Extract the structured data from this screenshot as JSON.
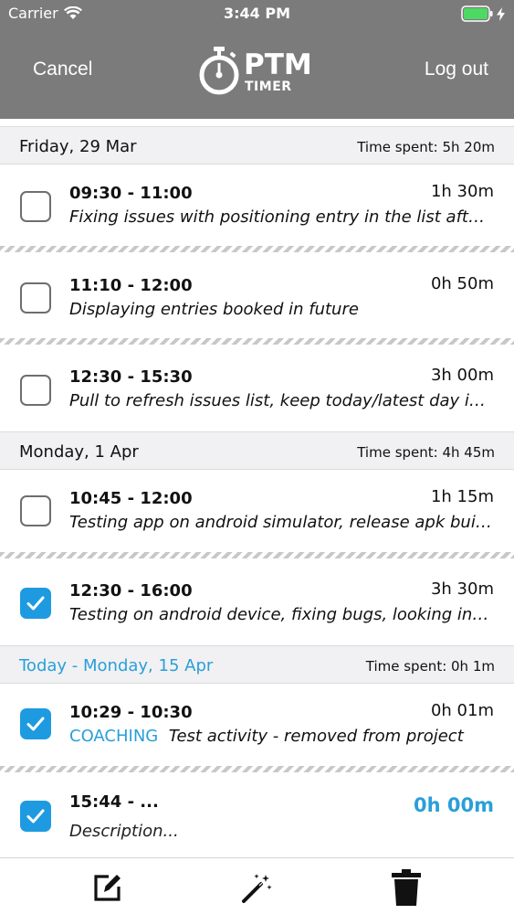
{
  "status_bar": {
    "carrier": "Carrier",
    "time": "3:44 PM",
    "battery_color": "#4cd964"
  },
  "header": {
    "cancel_label": "Cancel",
    "logout_label": "Log out",
    "logo_main": "PTM",
    "logo_sub": "TIMER"
  },
  "sections": [
    {
      "date": "Friday, 29 Mar",
      "time_spent": "Time spent: 5h 20m",
      "entries": [
        {
          "range": "09:30 - 11:00",
          "duration": "1h 30m",
          "description": "Fixing issues with positioning entry in the list after changing date",
          "checked": false
        },
        {
          "range": "11:10 - 12:00",
          "duration": "0h 50m",
          "description": "Displaying entries booked in future",
          "checked": false
        },
        {
          "range": "12:30 - 15:30",
          "duration": "3h 00m",
          "description": "Pull to refresh issues list,  keep today/latest day in view",
          "checked": false
        }
      ]
    },
    {
      "date": "Monday, 1 Apr",
      "time_spent": "Time spent: 4h 45m",
      "entries": [
        {
          "range": "10:45 - 12:00",
          "duration": "1h 15m",
          "description": "Testing app on android simulator, release apk build, reporting",
          "checked": false
        },
        {
          "range": "12:30 - 16:00",
          "duration": "3h 30m",
          "description": "Testing on android device, fixing bugs, looking into what else",
          "checked": true
        }
      ]
    },
    {
      "date": "Today - Monday, 15 Apr",
      "time_spent": "Time spent: 0h 1m",
      "entries": [
        {
          "range": "10:29 - 10:30",
          "duration": "0h 01m",
          "tag": "COACHING",
          "description": "Test activity - removed from project",
          "checked": true
        },
        {
          "range": "15:44 - ...",
          "duration": "0h 00m",
          "description": "Description...",
          "checked": true
        }
      ]
    }
  ],
  "toolbar": {
    "icons": [
      "edit-icon",
      "magic-wand-icon",
      "trash-icon"
    ]
  },
  "colors": {
    "header_bg": "#7b7b7b",
    "accent": "#2a9fd8",
    "checkbox_checked": "#1e9be0"
  }
}
